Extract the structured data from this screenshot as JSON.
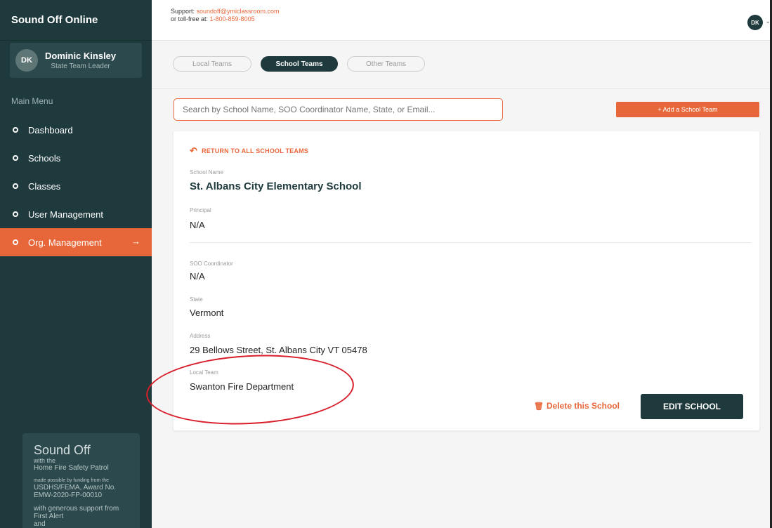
{
  "sidebar": {
    "brand": "Sound Off Online",
    "user": {
      "initials": "DK",
      "name": "Dominic Kinsley",
      "role": "State Team Leader"
    },
    "menu_label": "Main Menu",
    "items": [
      {
        "label": "Dashboard"
      },
      {
        "label": "Schools"
      },
      {
        "label": "Classes"
      },
      {
        "label": "User Management"
      },
      {
        "label": "Org. Management",
        "active": true
      }
    ],
    "promo": {
      "title": "Sound Off",
      "line1": "with the",
      "line2": "Home Fire Safety Patrol",
      "funding1": "made possible by funding from the",
      "funding2": "USDHS/FEMA, Award No.",
      "funding3": "EMW-2020-FP-00010",
      "support1": "with generous support from",
      "support2": "First Alert",
      "support3": "and"
    }
  },
  "header": {
    "support_prefix": "Support: ",
    "support_email": "soundoff@ymiclassroom.com",
    "tollfree_prefix": "or toll-free at: ",
    "tollfree_number": "1-800-859-8005",
    "user_initials": "DK",
    "caret": "⌄"
  },
  "tabs": [
    {
      "label": "Local Teams"
    },
    {
      "label": "School Teams",
      "active": true
    },
    {
      "label": "Other Teams"
    }
  ],
  "search": {
    "placeholder": "Search by School Name, SOO Coordinator Name, State, or Email..."
  },
  "add_button": "+ Add a School Team",
  "card": {
    "return_label": "RETURN TO ALL SCHOOL TEAMS",
    "fields": {
      "school_name": {
        "label": "School Name",
        "value": "St. Albans City Elementary School"
      },
      "principal": {
        "label": "Principal",
        "value": "N/A"
      },
      "coordinator": {
        "label": "SOO Coordinator",
        "value": "N/A"
      },
      "state": {
        "label": "State",
        "value": "Vermont"
      },
      "address": {
        "label": "Address",
        "value": "29 Bellows Street, St. Albans City VT 05478"
      },
      "local_team": {
        "label": "Local Team",
        "value": "Swanton Fire Department"
      }
    },
    "delete_label": "Delete this School",
    "edit_label": "EDIT SCHOOL"
  },
  "colors": {
    "sidebar": "#1e3a3d",
    "accent": "#e8673a",
    "annotation": "#d81e2a"
  }
}
